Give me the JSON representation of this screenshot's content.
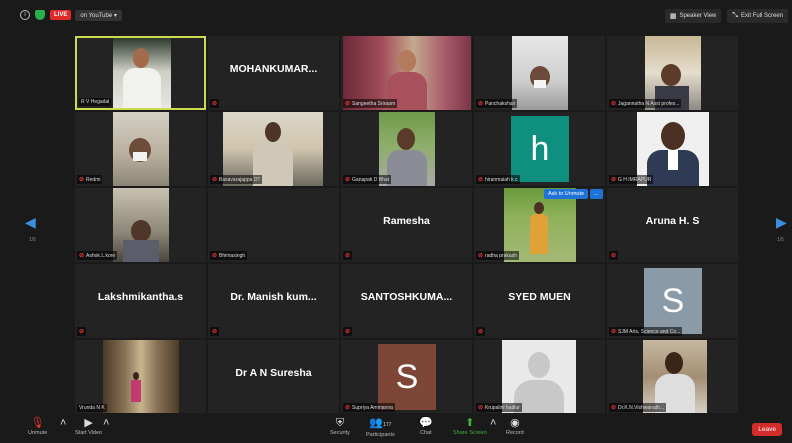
{
  "topbar": {
    "live": "LIVE",
    "stream_target": "on YouTube",
    "speaker_view": "Speaker View",
    "exit_full_screen": "Exit Full Screen"
  },
  "page_left": "1/5",
  "page_right": "1/5",
  "ask_to_unmute": "Ask to Unmute",
  "ask_more": "...",
  "tiles": [
    {
      "name": "R V Hegadal",
      "display": ""
    },
    {
      "name": "",
      "display": "MOHANKUMAR..."
    },
    {
      "name": "Sangeetha Sriraam",
      "display": ""
    },
    {
      "name": "Panchakshari",
      "display": ""
    },
    {
      "name": "Jagannatha N Asst profes...",
      "display": ""
    },
    {
      "name": "Redmi",
      "display": ""
    },
    {
      "name": "Basavarajappa DT",
      "display": ""
    },
    {
      "name": "Ganapati D Bhat",
      "display": ""
    },
    {
      "name": "hiranmaiah k c",
      "display": "",
      "avatar": "h"
    },
    {
      "name": "G H IMRAPUR",
      "display": ""
    },
    {
      "name": "Ashok.L.kore",
      "display": ""
    },
    {
      "name": "Bhimasingh",
      "display": ""
    },
    {
      "name": "",
      "display": "Ramesha"
    },
    {
      "name": "radha prakash",
      "display": ""
    },
    {
      "name": "",
      "display": "Aruna H. S"
    },
    {
      "name": "",
      "display": "Lakshmikantha.s"
    },
    {
      "name": "",
      "display": "Dr. Manish kum..."
    },
    {
      "name": "",
      "display": "SANTOSHKUMA..."
    },
    {
      "name": "",
      "display": "SYED MUEN"
    },
    {
      "name": "SJM Arts, Science and Co...",
      "display": "",
      "avatar": "S"
    },
    {
      "name": "Vrunda N K",
      "display": ""
    },
    {
      "name": "",
      "display": "Dr A N Suresha"
    },
    {
      "name": "Supriya Ammanna",
      "display": "",
      "avatar": "S"
    },
    {
      "name": "Krupalini hadlur",
      "display": ""
    },
    {
      "name": "Dr.K.N.Vishwanath...",
      "display": ""
    }
  ],
  "bottombar": {
    "unmute": "Unmute",
    "start_video": "Start Video",
    "security": "Security",
    "participants": "Participants",
    "participants_count": "177",
    "chat": "Chat",
    "share_screen": "Share Screen",
    "record": "Record",
    "leave": "Leave"
  },
  "colors": {
    "active_border": "#cdd94e",
    "accent_blue": "#3b8fe0",
    "leave_red": "#d42b2b",
    "share_green": "#3fb23f",
    "avatar_h": "#0f8f80",
    "avatar_s1": "#8a9aa6",
    "avatar_s2": "#7d4636"
  }
}
